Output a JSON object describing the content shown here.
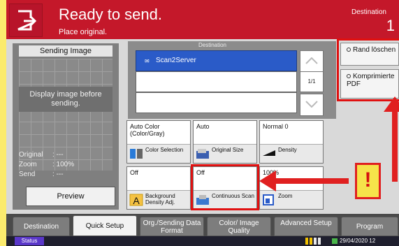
{
  "header": {
    "title": "Ready to send.",
    "subtitle": "Place original.",
    "destination_label": "Destination",
    "destination_count": "1"
  },
  "left_panel": {
    "title": "Sending Image",
    "message": "Display image before sending.",
    "info": [
      {
        "key": "Original",
        "value": ": ---"
      },
      {
        "key": "Zoom",
        "value": ": 100%"
      },
      {
        "key": "Send",
        "value": ": ---"
      }
    ],
    "preview_label": "Preview"
  },
  "destination": {
    "title": "Destination",
    "rows": [
      "Scan2Server",
      "",
      ""
    ],
    "page": "1/1"
  },
  "side_buttons": {
    "border_erase": "Rand löschen",
    "compressed_pdf": "Komprimierte PDF"
  },
  "tiles": [
    {
      "value": "Auto Color (Color/Gray)",
      "label": "Color Selection",
      "icon": "color-selection-icon"
    },
    {
      "value": "Auto",
      "label": "Original Size",
      "icon": "original-size-icon"
    },
    {
      "value": "Normal 0",
      "label": "Density",
      "icon": "density-icon"
    },
    {
      "value": "Off",
      "label": "Background Density Adj.",
      "icon": "background-density-icon"
    },
    {
      "value": "Off",
      "label": "Continuous Scan",
      "icon": "continuous-scan-icon"
    },
    {
      "value": "100%",
      "label": "Zoom",
      "icon": "zoom-icon"
    }
  ],
  "warning_mark": "!",
  "tabs": [
    {
      "label": "Destination"
    },
    {
      "label": "Quick Setup",
      "active": true
    },
    {
      "label": "Org./Sending Data Format"
    },
    {
      "label": "Color/ Image Quality"
    },
    {
      "label": "Advanced Setup"
    },
    {
      "label": "Program"
    }
  ],
  "statusbar": {
    "status_label": "Status",
    "date": "29/04/2020 12"
  },
  "colors": {
    "header_red": "#c4182a",
    "highlight_red": "#e01010",
    "selected_blue": "#2a5bc8",
    "status_purple": "#5a37c9",
    "background_yellow": "#fbeb6e"
  }
}
